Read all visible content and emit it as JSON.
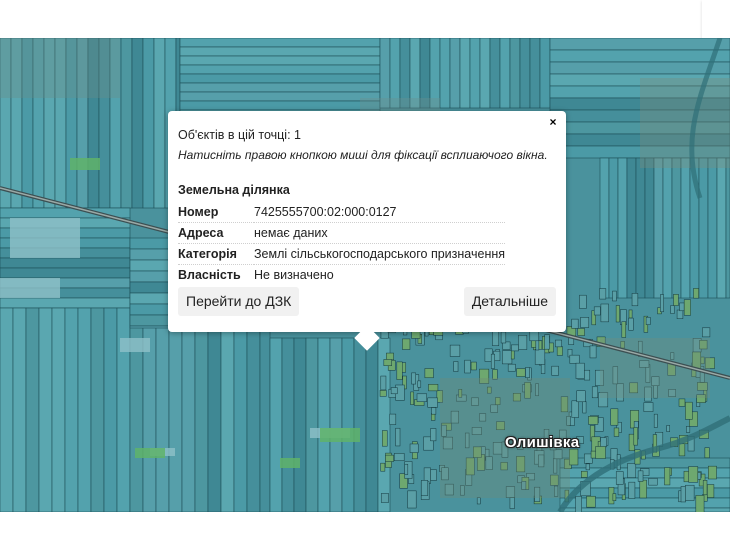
{
  "map": {
    "place_name": "Олишівка"
  },
  "popup": {
    "close_label": "×",
    "objects_count": "Об'єктів в цій точці: 1",
    "hint": "Натисніть правою кнопкою миші для фіксації всплиаючого вікна.",
    "section_title": "Земельна ділянка",
    "rows": [
      {
        "key": "Номер",
        "value": "7425555700:02:000:0127"
      },
      {
        "key": "Адреса",
        "value": "немає даних"
      },
      {
        "key": "Категорія",
        "value": "Землі сільськогосподарського призначення"
      },
      {
        "key": "Власність",
        "value": "Не визначено"
      }
    ],
    "buttons": {
      "goto_dzk": "Перейти до ДЗК",
      "details": "Детальніше"
    }
  }
}
